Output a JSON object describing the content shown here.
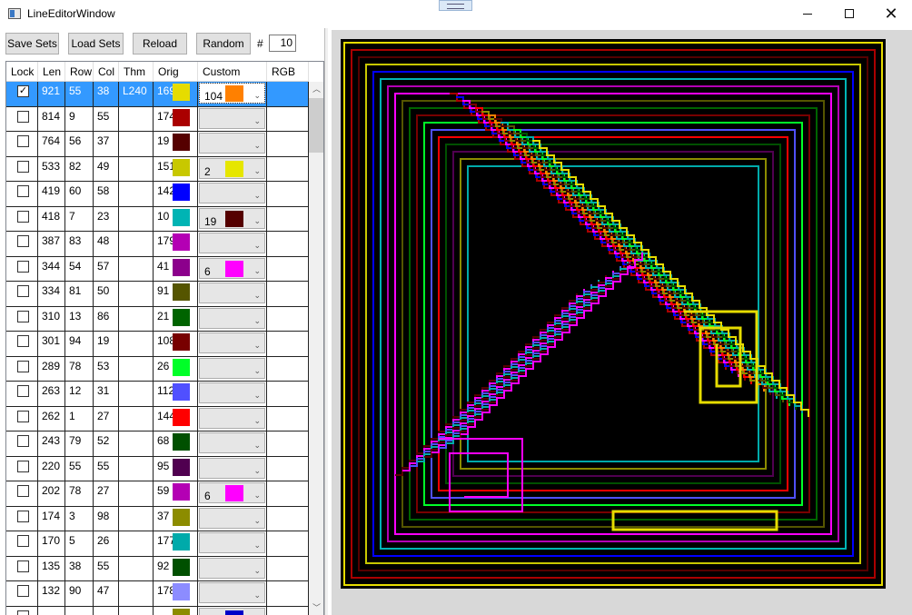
{
  "window": {
    "title": "LineEditorWindow"
  },
  "toolbar": {
    "save_label": "Save Sets",
    "load_label": "Load Sets",
    "reload_label": "Reload",
    "random_label": "Random",
    "count_symbol": "#",
    "count_value": "10"
  },
  "grid": {
    "columns": [
      "Lock",
      "Len",
      "Row",
      "Col",
      "Thm",
      "Orig",
      "Custom",
      "RGB"
    ],
    "rows": [
      {
        "lock": true,
        "len": "921",
        "row": "55",
        "col": "38",
        "thm": "L240",
        "orig": "169",
        "orig_color": "#e6dc00",
        "custom": "104",
        "custom_color": "#ff8000",
        "selected": true
      },
      {
        "lock": false,
        "len": "814",
        "row": "9",
        "col": "55",
        "thm": "",
        "orig": "174",
        "orig_color": "#aa0000",
        "custom": "",
        "custom_color": ""
      },
      {
        "lock": false,
        "len": "764",
        "row": "56",
        "col": "37",
        "thm": "",
        "orig": "19",
        "orig_color": "#550000",
        "custom": "",
        "custom_color": ""
      },
      {
        "lock": false,
        "len": "533",
        "row": "82",
        "col": "49",
        "thm": "",
        "orig": "151",
        "orig_color": "#c8c800",
        "custom": "2",
        "custom_color": "#e6e600"
      },
      {
        "lock": false,
        "len": "419",
        "row": "60",
        "col": "58",
        "thm": "",
        "orig": "142",
        "orig_color": "#0000ff",
        "custom": "",
        "custom_color": ""
      },
      {
        "lock": false,
        "len": "418",
        "row": "7",
        "col": "23",
        "thm": "",
        "orig": "10",
        "orig_color": "#00b4b4",
        "custom": "19",
        "custom_color": "#550000"
      },
      {
        "lock": false,
        "len": "387",
        "row": "83",
        "col": "48",
        "thm": "",
        "orig": "179",
        "orig_color": "#b400b4",
        "custom": "",
        "custom_color": ""
      },
      {
        "lock": false,
        "len": "344",
        "row": "54",
        "col": "57",
        "thm": "",
        "orig": "41",
        "orig_color": "#8c008c",
        "custom": "6",
        "custom_color": "#ff00ff"
      },
      {
        "lock": false,
        "len": "334",
        "row": "81",
        "col": "50",
        "thm": "",
        "orig": "91",
        "orig_color": "#555500",
        "custom": "",
        "custom_color": ""
      },
      {
        "lock": false,
        "len": "310",
        "row": "13",
        "col": "86",
        "thm": "",
        "orig": "21",
        "orig_color": "#006400",
        "custom": "",
        "custom_color": ""
      },
      {
        "lock": false,
        "len": "301",
        "row": "94",
        "col": "19",
        "thm": "",
        "orig": "108",
        "orig_color": "#780000",
        "custom": "",
        "custom_color": ""
      },
      {
        "lock": false,
        "len": "289",
        "row": "78",
        "col": "53",
        "thm": "",
        "orig": "26",
        "orig_color": "#00ff28",
        "custom": "",
        "custom_color": ""
      },
      {
        "lock": false,
        "len": "263",
        "row": "12",
        "col": "31",
        "thm": "",
        "orig": "112",
        "orig_color": "#5050ff",
        "custom": "",
        "custom_color": ""
      },
      {
        "lock": false,
        "len": "262",
        "row": "1",
        "col": "27",
        "thm": "",
        "orig": "144",
        "orig_color": "#ff0000",
        "custom": "",
        "custom_color": ""
      },
      {
        "lock": false,
        "len": "243",
        "row": "79",
        "col": "52",
        "thm": "",
        "orig": "68",
        "orig_color": "#005000",
        "custom": "",
        "custom_color": ""
      },
      {
        "lock": false,
        "len": "220",
        "row": "55",
        "col": "55",
        "thm": "",
        "orig": "95",
        "orig_color": "#500050",
        "custom": "",
        "custom_color": ""
      },
      {
        "lock": false,
        "len": "202",
        "row": "78",
        "col": "27",
        "thm": "",
        "orig": "59",
        "orig_color": "#b400b4",
        "custom": "6",
        "custom_color": "#ff00ff"
      },
      {
        "lock": false,
        "len": "174",
        "row": "3",
        "col": "98",
        "thm": "",
        "orig": "37",
        "orig_color": "#8c8c00",
        "custom": "",
        "custom_color": ""
      },
      {
        "lock": false,
        "len": "170",
        "row": "5",
        "col": "26",
        "thm": "",
        "orig": "177",
        "orig_color": "#00aaaa",
        "custom": "",
        "custom_color": ""
      },
      {
        "lock": false,
        "len": "135",
        "row": "38",
        "col": "55",
        "thm": "",
        "orig": "92",
        "orig_color": "#005000",
        "custom": "",
        "custom_color": ""
      },
      {
        "lock": false,
        "len": "132",
        "row": "90",
        "col": "47",
        "thm": "",
        "orig": "178",
        "orig_color": "#8c8cff",
        "custom": "",
        "custom_color": ""
      },
      {
        "lock": false,
        "len": "",
        "row": "",
        "col": "",
        "thm": "",
        "orig": "",
        "orig_color": "#8c8c00",
        "custom": "",
        "custom_color": "#0000c8"
      }
    ]
  },
  "maze": {
    "background": "#000000",
    "line_colors": [
      "#e6dc00",
      "#aa0000",
      "#550000",
      "#c8c800",
      "#0000ff",
      "#00b4b4",
      "#b400b4",
      "#ff00ff",
      "#555500",
      "#006400",
      "#780000",
      "#00ff28",
      "#5050ff",
      "#ff0000",
      "#005000",
      "#500050",
      "#8c8c00",
      "#00aaaa",
      "#8c8cff",
      "#ff8000"
    ]
  }
}
